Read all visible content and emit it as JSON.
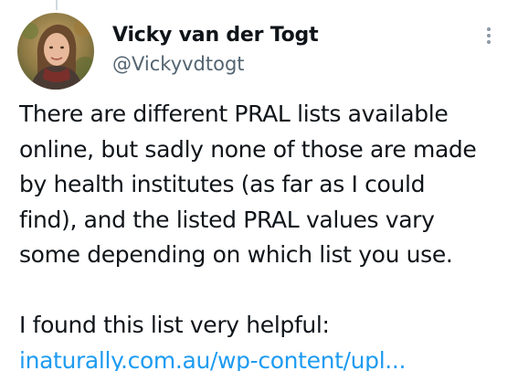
{
  "author": {
    "display_name": "Vicky van der Togt",
    "handle": "@Vickyvdtogt",
    "avatar_icon": "profile-photo"
  },
  "menu": {
    "icon": "more-vertical-icon"
  },
  "tweet": {
    "lines": [
      "There are different PRAL lists available",
      "online, but sadly none of those are made",
      "by health institutes (as far as I could",
      "find), and the listed PRAL values vary",
      "some depending on which list you use."
    ],
    "second_paragraph": "I found this list very helpful:",
    "link_text": "inaturally.com.au/wp-content/upl..."
  },
  "colors": {
    "text": "#0f1419",
    "secondary": "#536471",
    "link": "#1d9bf0"
  }
}
